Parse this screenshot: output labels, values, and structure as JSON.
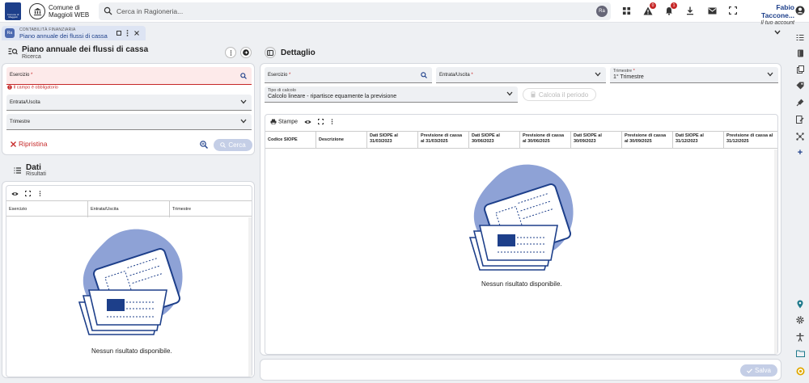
{
  "brand": {
    "logo_text": "Comune di Maggioli",
    "org_line1": "Comune di",
    "org_line2": "Maggioli WEB"
  },
  "search": {
    "placeholder": "Cerca in Ragioneria..."
  },
  "user": {
    "name": "Fabio Taccone...",
    "subtitle": "Il tuo account"
  },
  "notifications": {
    "alerts_count": "0",
    "bell_count": "1"
  },
  "tab": {
    "category": "CONTABILITÀ FINANZIARIA",
    "title": "Piano annuale dei flussi di cassa"
  },
  "left": {
    "title": "Piano annuale dei flussi di cassa",
    "subtitle": "Ricerca",
    "esercizio_label": "Esercizio",
    "required_mark": "*",
    "error_text": "Il campo è obbligatorio",
    "entrata_label": "Entrata/Uscita",
    "trimestre_label": "Trimestre",
    "reset_label": "Ripristina",
    "search_label": "Cerca",
    "results_title": "Dati",
    "results_subtitle": "Risultati",
    "columns": [
      "Esercizio",
      "Entrata/Uscita",
      "Trimestre"
    ],
    "empty_message": "Nessun risultato disponibile."
  },
  "right": {
    "title": "Dettaglio",
    "esercizio_label": "Esercizio",
    "entrata_label": "Entrata/Uscita",
    "trimestre_label": "Trimestre",
    "trimestre_value": "1° Trimestre",
    "tipo_label": "Tipo di calcolo",
    "tipo_value": "Calcolo lineare - ripartisce equamente la previsione",
    "calc_label": "Calcola il periodo",
    "stampe_label": "Stampe",
    "columns": [
      "Codice SIOPE",
      "Descrizione",
      "Dati SIOPE al 31/03/2023",
      "Previsione di cassa al 31/03/2025",
      "Dati SIOPE al 30/06/2023",
      "Previsione di cassa al 30/06/2025",
      "Dati SIOPE al 30/09/2023",
      "Previsione di cassa al 30/09/2025",
      "Dati SIOPE al 31/12/2023",
      "Previsione di cassa al 31/12/2025"
    ],
    "empty_message": "Nessun risultato disponibile.",
    "save_label": "Salva"
  },
  "colors": {
    "accent": "#1d3f8a",
    "error": "#c62828",
    "illustration": "#8ea2d6"
  }
}
